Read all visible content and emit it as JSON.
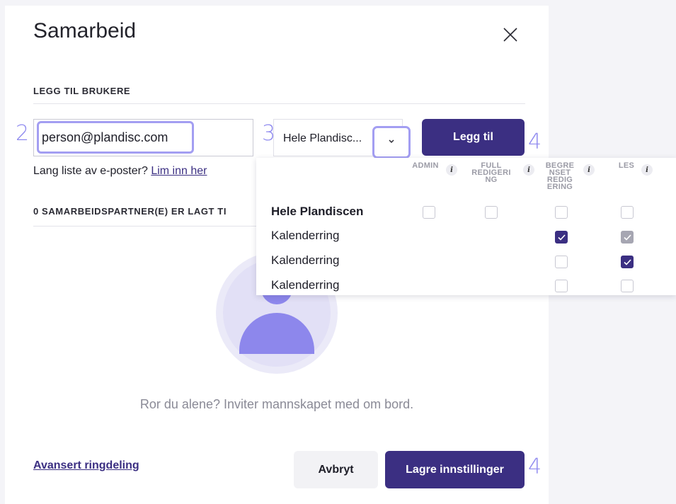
{
  "dialog": {
    "title": "Samarbeid",
    "add_users_heading": "LEGG TIL BRUKERE",
    "email_value": "person@plandisc.com",
    "scope_value": "Hele Plandisc...",
    "add_button": "Legg til",
    "hint_text": "Lang liste av e-poster?",
    "hint_link": "Lim inn her",
    "partners_heading": "0 SAMARBEIDSPARTNER(E) ER LAGT TI",
    "empty_text": "Ror du alene? Inviter mannskapet med om bord.",
    "advanced_link": "Avansert ringdeling",
    "cancel_button": "Avbryt",
    "save_button": "Lagre innstillinger"
  },
  "steps": [
    "2",
    "3",
    "4",
    "4"
  ],
  "dropdown": {
    "columns": [
      {
        "label": "ADMIN"
      },
      {
        "label": "FULL REDIGERI NG"
      },
      {
        "label": "BEGRE NSET REDIG ERING"
      },
      {
        "label": "LES"
      }
    ],
    "rows": [
      {
        "label": "Hele Plandiscen",
        "bold": true,
        "checks": [
          "off",
          "off",
          "off",
          "off"
        ]
      },
      {
        "label": "Kalenderring",
        "bold": false,
        "checks": [
          null,
          null,
          "on",
          "disabled-on"
        ]
      },
      {
        "label": "Kalenderring",
        "bold": false,
        "checks": [
          null,
          null,
          "off",
          "on"
        ]
      },
      {
        "label": "Kalenderring",
        "bold": false,
        "checks": [
          null,
          null,
          "off",
          "off"
        ]
      }
    ]
  },
  "colors": {
    "primary": "#3b2f82",
    "highlight": "#a39ef2",
    "step_number": "#8f8aef",
    "avatar": "#8d87ec"
  },
  "icons": {
    "close": "close-icon",
    "chevron": "chevron-down-icon",
    "info": "info-icon",
    "avatar": "user-avatar-icon"
  }
}
